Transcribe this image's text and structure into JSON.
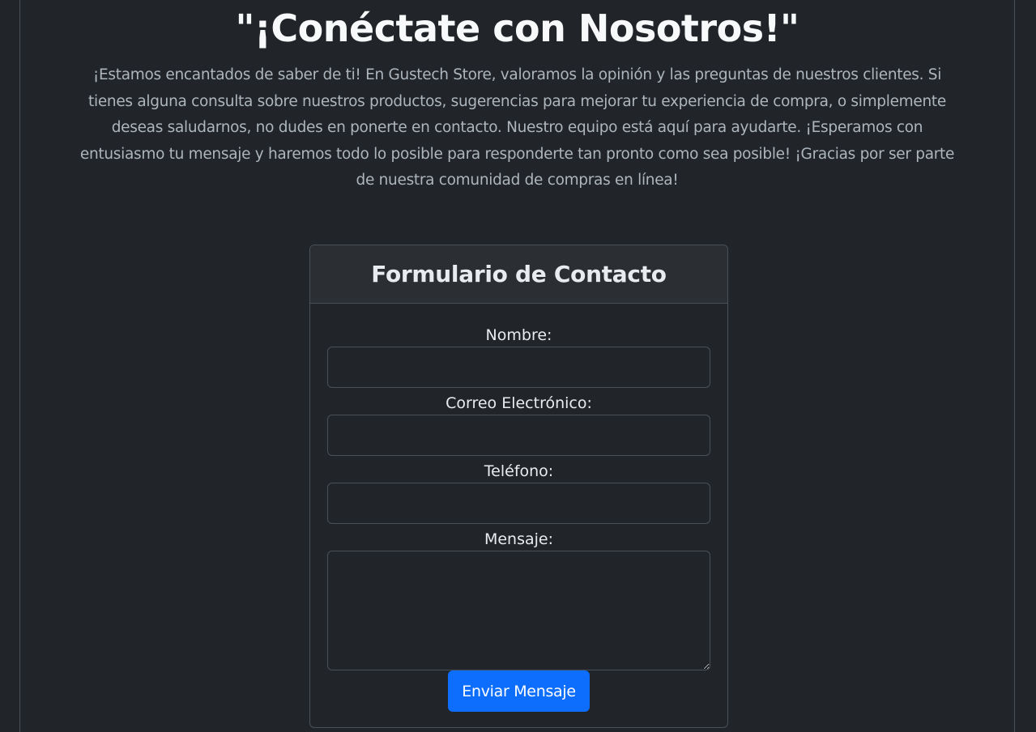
{
  "hero": {
    "title": "\"¡Conéctate con Nosotros!\"",
    "text": "¡Estamos encantados de saber de ti! En Gustech Store, valoramos la opinión y las preguntas de nuestros clientes. Si tienes alguna consulta sobre nuestros productos, sugerencias para mejorar tu experiencia de compra, o simplemente deseas saludarnos, no dudes en ponerte en contacto. Nuestro equipo está aquí para ayudarte. ¡Esperamos con entusiasmo tu mensaje y haremos todo lo posible para responderte tan pronto como sea posible! ¡Gracias por ser parte de nuestra comunidad de compras en línea!"
  },
  "form": {
    "title": "Formulario de Contacto",
    "name_label": "Nombre:",
    "name_value": "",
    "email_label": "Correo Electrónico:",
    "email_value": "",
    "phone_label": "Teléfono:",
    "phone_value": "",
    "message_label": "Mensaje:",
    "message_value": "",
    "submit_label": "Enviar Mensaje"
  },
  "colors": {
    "background": "#212529",
    "card_header": "#2b2f33",
    "border": "#495057",
    "primary": "#0d6efd"
  }
}
